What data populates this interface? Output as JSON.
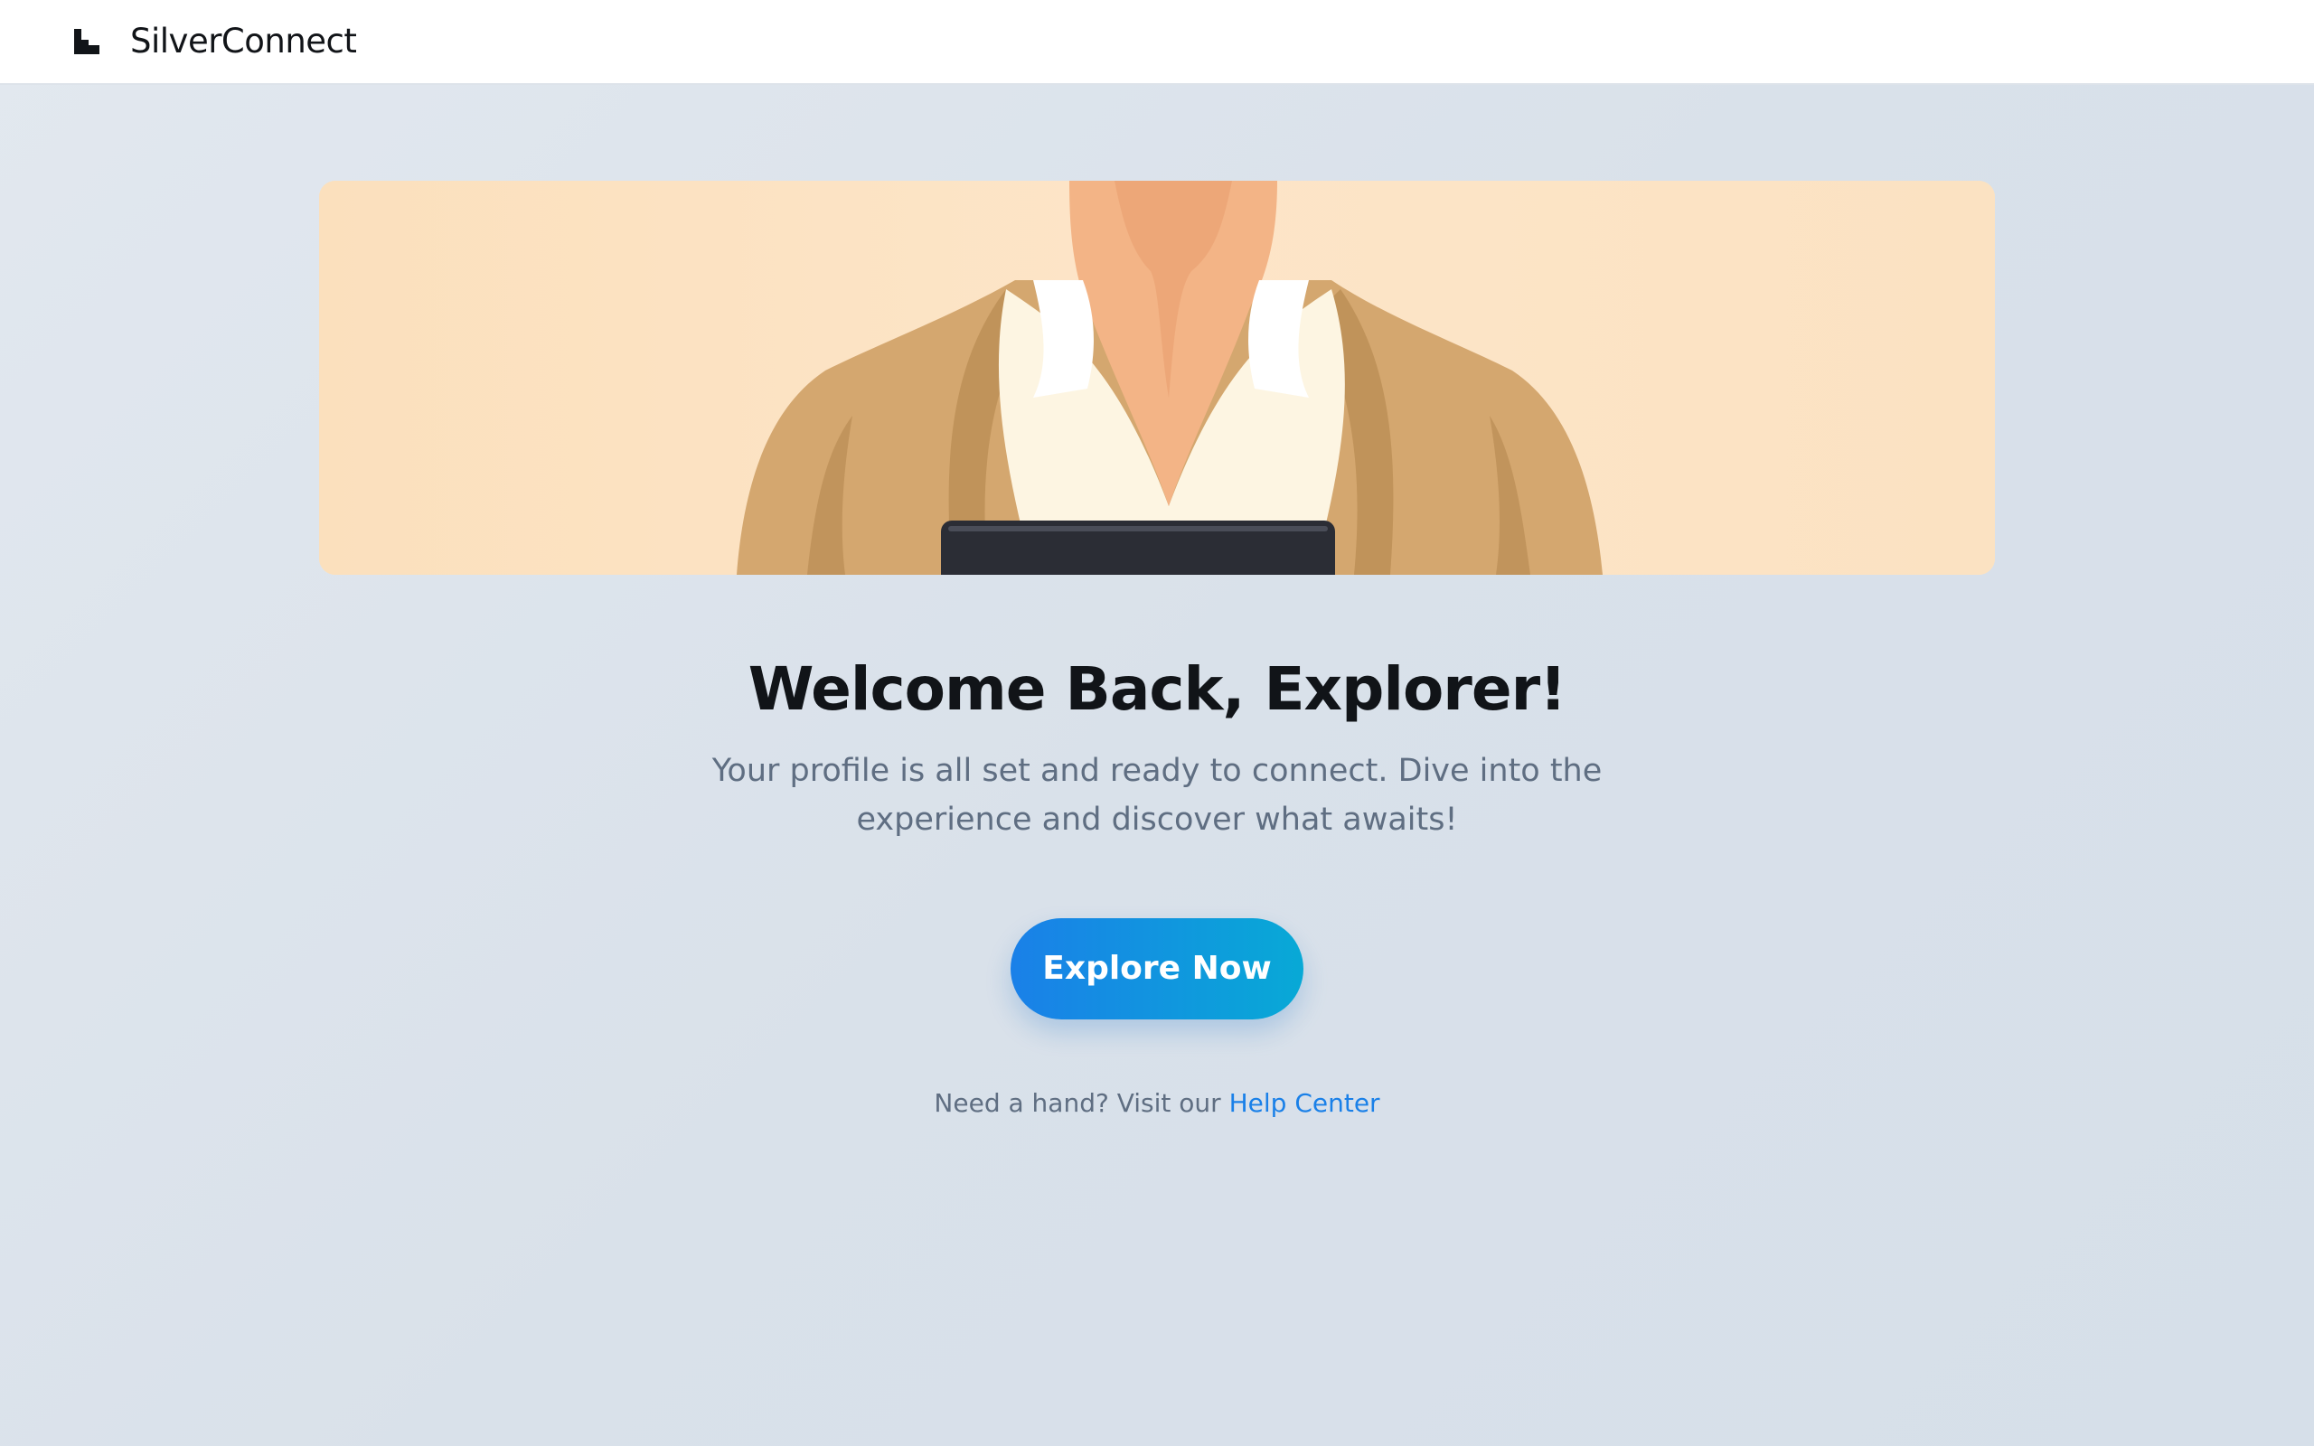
{
  "header": {
    "brand": "SilverConnect",
    "logo_icon": "stepped-bars-logo-icon"
  },
  "hero": {
    "image": "illustration of person in tan cardigan holding a tablet",
    "background_color": "#fbe3c3"
  },
  "main": {
    "title": "Welcome Back, Explorer!",
    "subtitle": "Your profile is all set and ready to connect. Dive into the experience and discover what awaits!",
    "cta_label": "Explore Now",
    "help_prefix": "Need a hand? Visit our ",
    "help_link": "Help Center"
  },
  "colors": {
    "accent": "#1a80e8",
    "accent_end": "#08a9d6",
    "text_dark": "#111418",
    "text_muted": "#5f6e82"
  }
}
